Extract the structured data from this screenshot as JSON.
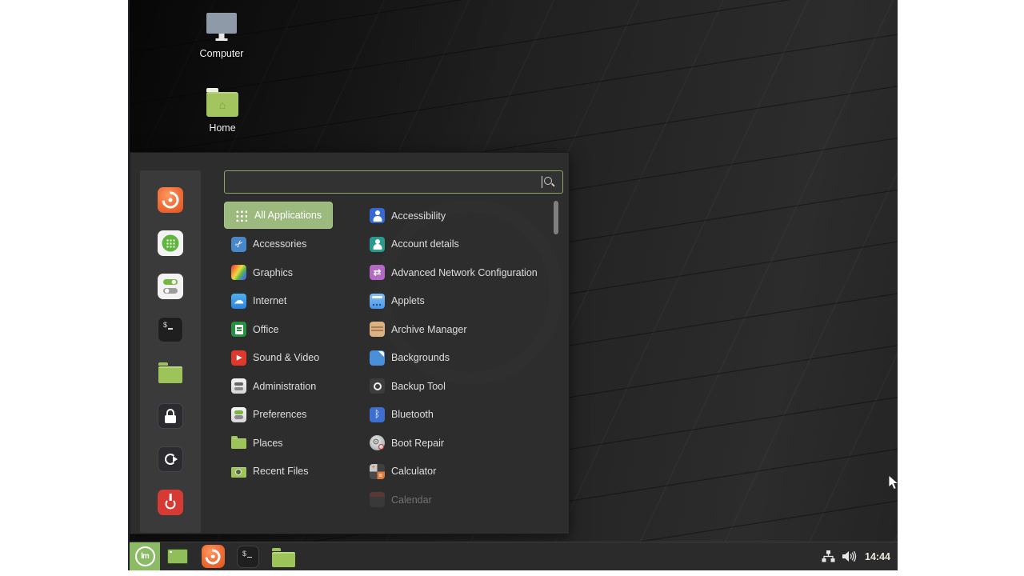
{
  "desktop": {
    "icons": [
      {
        "label": "Computer",
        "icon": "computer-monitor-icon"
      },
      {
        "label": "Home",
        "icon": "home-folder-icon"
      }
    ]
  },
  "menu": {
    "search": {
      "value": "",
      "placeholder": "",
      "icon": "search-icon"
    },
    "favorites": [
      {
        "name": "firefox",
        "icon": "firefox-icon"
      },
      {
        "name": "software-manager",
        "icon": "software-manager-icon"
      },
      {
        "name": "system-settings",
        "icon": "settings-toggles-icon"
      },
      {
        "name": "terminal",
        "icon": "terminal-icon"
      },
      {
        "name": "files",
        "icon": "folder-icon"
      },
      {
        "name": "lock-screen",
        "icon": "padlock-icon"
      },
      {
        "name": "logout",
        "icon": "logout-icon"
      },
      {
        "name": "quit",
        "icon": "power-icon"
      }
    ],
    "categories": [
      {
        "label": "All Applications",
        "icon": "grid-icon",
        "selected": true
      },
      {
        "label": "Accessories",
        "icon": "scissors-icon"
      },
      {
        "label": "Graphics",
        "icon": "rainbow-icon"
      },
      {
        "label": "Internet",
        "icon": "cloud-icon"
      },
      {
        "label": "Office",
        "icon": "document-icon"
      },
      {
        "label": "Sound & Video",
        "icon": "play-icon"
      },
      {
        "label": "Administration",
        "icon": "sliders-icon"
      },
      {
        "label": "Preferences",
        "icon": "sliders-green-icon"
      },
      {
        "label": "Places",
        "icon": "folder-icon"
      },
      {
        "label": "Recent Files",
        "icon": "folder-clock-icon"
      }
    ],
    "applications": [
      {
        "label": "Accessibility",
        "icon": "accessibility-person-icon"
      },
      {
        "label": "Account details",
        "icon": "user-bust-icon"
      },
      {
        "label": "Advanced Network Configuration",
        "icon": "network-arrows-icon"
      },
      {
        "label": "Applets",
        "icon": "panel-applets-icon"
      },
      {
        "label": "Archive Manager",
        "icon": "archive-box-icon"
      },
      {
        "label": "Backgrounds",
        "icon": "wallpaper-page-icon"
      },
      {
        "label": "Backup Tool",
        "icon": "backup-circle-icon"
      },
      {
        "label": "Bluetooth",
        "icon": "bluetooth-icon"
      },
      {
        "label": "Boot Repair",
        "icon": "disc-magnifier-icon"
      },
      {
        "label": "Calculator",
        "icon": "calculator-icon"
      },
      {
        "label": "Calendar",
        "icon": "calendar-icon",
        "disabled": true
      }
    ]
  },
  "taskbar": {
    "launchers": [
      {
        "name": "menu",
        "icon": "mint-logo-icon",
        "active": true
      },
      {
        "name": "show-desktop",
        "icon": "window-icon"
      },
      {
        "name": "firefox",
        "icon": "firefox-icon"
      },
      {
        "name": "terminal",
        "icon": "terminal-icon"
      },
      {
        "name": "files",
        "icon": "folder-icon"
      }
    ],
    "tray": {
      "network_icon": "wired-network-icon",
      "volume_icon": "speaker-icon",
      "clock": "14:44"
    }
  },
  "colors": {
    "accent_green": "#9cba7d",
    "search_border": "#8aa565",
    "menu_bg": "#2d2d2d",
    "sidebar_bg": "#3a3a3a",
    "taskbar_bg": "#2b2b2b",
    "label_text": "#dedede",
    "menu_button_green": "#8cbb66"
  }
}
